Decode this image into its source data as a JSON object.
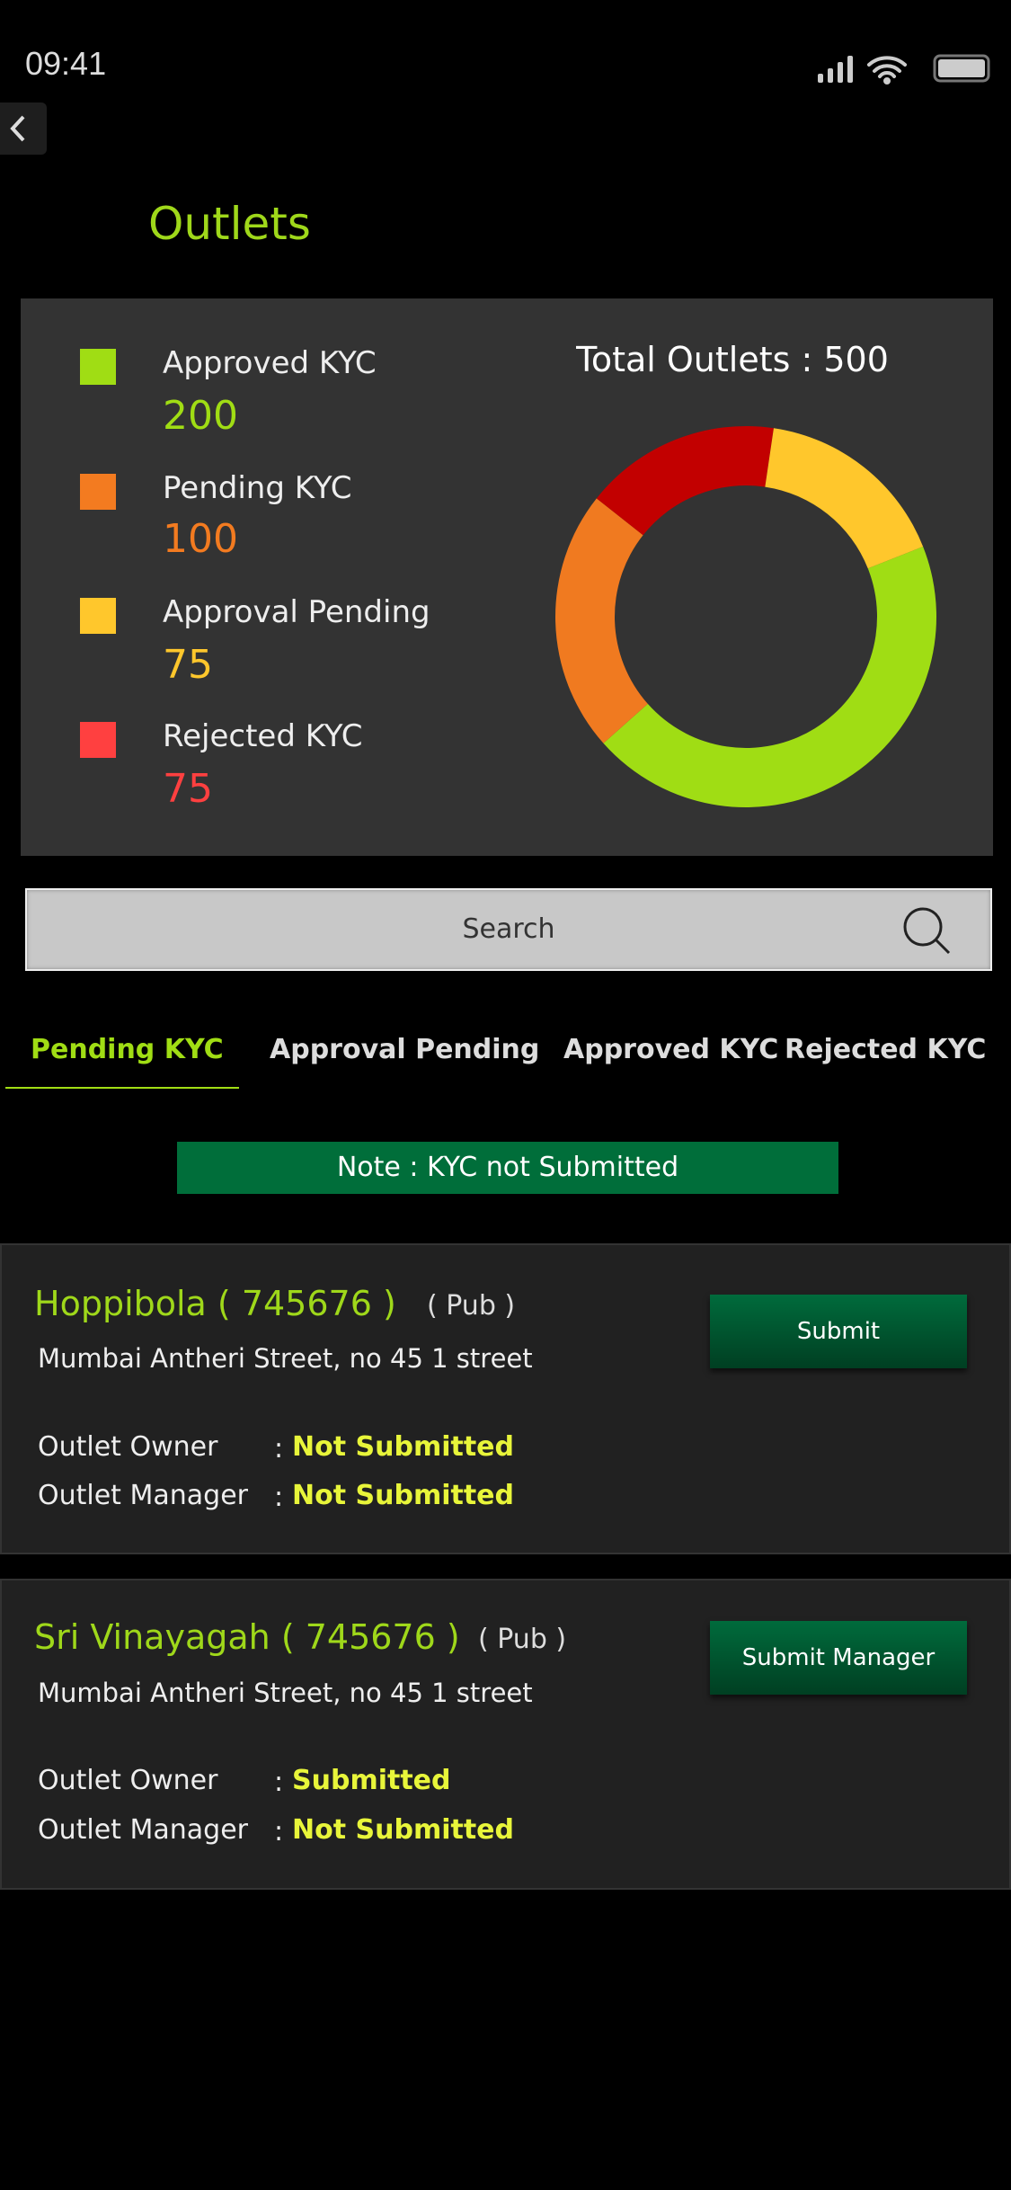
{
  "status_bar": {
    "time": "09:41",
    "icons": [
      "signal-icon",
      "wifi-icon",
      "battery-icon"
    ]
  },
  "header": {
    "title": "Outlets",
    "back_icon": "chevron-left-icon"
  },
  "summary": {
    "total_label": "Total Outlets : 500",
    "legend": [
      {
        "label": "Approved KYC",
        "value": "200",
        "color": "#a0dd14"
      },
      {
        "label": "Pending KYC",
        "value": "100",
        "color": "#f37b20"
      },
      {
        "label": "Approval Pending",
        "value": "75",
        "color": "#ffc72c"
      },
      {
        "label": "Rejected KYC",
        "value": "75",
        "color": "#ff4040"
      }
    ]
  },
  "chart_data": {
    "type": "pie",
    "variant": "donut",
    "categories": [
      "Approved KYC",
      "Pending KYC",
      "Rejected KYC",
      "Approval Pending"
    ],
    "values": [
      200,
      100,
      75,
      75
    ],
    "colors": [
      "#a0dd14",
      "#f07a20",
      "#c20000",
      "#ffc72c"
    ],
    "title": "Total Outlets : 500"
  },
  "search": {
    "placeholder": "Search",
    "icon": "search-icon"
  },
  "tabs": [
    {
      "label": "Pending KYC",
      "active": true
    },
    {
      "label": "Approval Pending"
    },
    {
      "label": "Approved KYC"
    },
    {
      "label": "Rejected KYC"
    }
  ],
  "note": "Note : KYC not Submitted",
  "outlets": [
    {
      "name": "Hoppibola ( 745676 )",
      "type": "( Pub )",
      "address": "Mumbai Antheri Street, no 45 1 street",
      "owner_label": "Outlet Owner",
      "owner_status": "Not Submitted",
      "manager_label": "Outlet Manager",
      "manager_status": "Not Submitted",
      "button": "Submit"
    },
    {
      "name": "Sri Vinayagah ( 745676 )",
      "type": "( Pub )",
      "address": "Mumbai Antheri Street, no 45 1 street",
      "owner_label": "Outlet Owner",
      "owner_status": "Submitted",
      "manager_label": "Outlet Manager",
      "manager_status": "Not Submitted",
      "button": "Submit Manager"
    }
  ],
  "colon": ":"
}
